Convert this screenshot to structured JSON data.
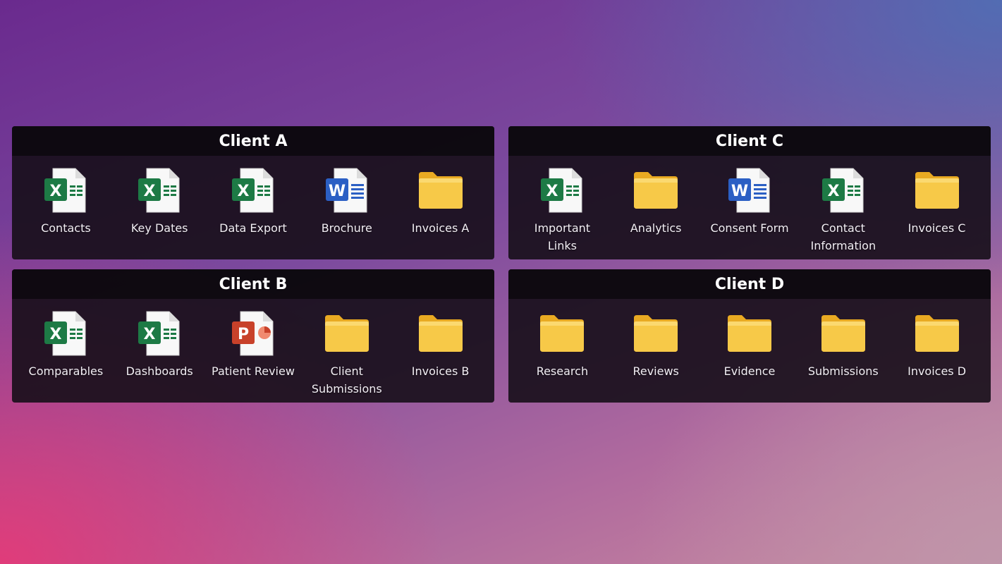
{
  "panels": [
    {
      "title": "Client A",
      "items": [
        {
          "label": "Contacts",
          "icon": "excel-file-icon"
        },
        {
          "label": "Key Dates",
          "icon": "excel-file-icon"
        },
        {
          "label": "Data Export",
          "icon": "excel-file-icon"
        },
        {
          "label": "Brochure",
          "icon": "word-file-icon"
        },
        {
          "label": "Invoices A",
          "icon": "folder-icon"
        }
      ]
    },
    {
      "title": "Client C",
      "items": [
        {
          "label": "Important Links",
          "icon": "excel-file-icon"
        },
        {
          "label": "Analytics",
          "icon": "folder-icon"
        },
        {
          "label": "Consent Form",
          "icon": "word-file-icon"
        },
        {
          "label": "Contact Information",
          "icon": "excel-file-icon"
        },
        {
          "label": "Invoices C",
          "icon": "folder-icon"
        }
      ]
    },
    {
      "title": "Client B",
      "items": [
        {
          "label": "Comparables",
          "icon": "excel-file-icon"
        },
        {
          "label": "Dashboards",
          "icon": "excel-file-icon"
        },
        {
          "label": "Patient Review",
          "icon": "powerpoint-file-icon"
        },
        {
          "label": "Client Submissions",
          "icon": "folder-icon"
        },
        {
          "label": "Invoices B",
          "icon": "folder-icon"
        }
      ]
    },
    {
      "title": "Client D",
      "items": [
        {
          "label": "Research",
          "icon": "folder-icon"
        },
        {
          "label": "Reviews",
          "icon": "folder-icon"
        },
        {
          "label": "Evidence",
          "icon": "folder-icon"
        },
        {
          "label": "Submissions",
          "icon": "folder-icon"
        },
        {
          "label": "Invoices D",
          "icon": "folder-icon"
        }
      ]
    }
  ],
  "colors": {
    "excel": "#1d7a45",
    "word": "#2b5fc4",
    "powerpoint": "#c8412a",
    "folder": "#f7c948"
  }
}
